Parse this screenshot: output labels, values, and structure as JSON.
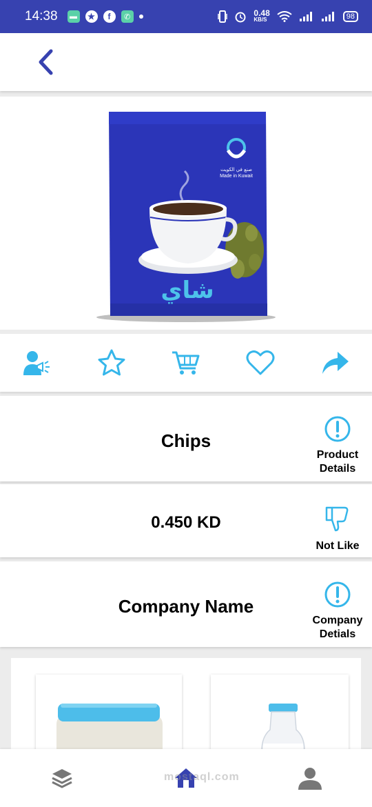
{
  "status_bar": {
    "time": "14:38",
    "network_speed": "0.48",
    "network_unit": "KB/S",
    "battery": "98"
  },
  "product_image": {
    "package_brand_line": "صنع في الكويت",
    "package_made_in": "Made in Kuwait",
    "package_title": "شاي",
    "colors": {
      "package": "#2b35b8",
      "accent": "#4dc3ea"
    }
  },
  "actions": {
    "icons": [
      "advertise-icon",
      "star-icon",
      "cart-icon",
      "heart-icon",
      "share-icon"
    ],
    "accent_color": "#35b6ea"
  },
  "product": {
    "name": "Chips",
    "price": "0.450 KD",
    "company": "Company Name",
    "details_label_line1": "Product",
    "details_label_line2": "Details",
    "not_like_label": "Not Like",
    "company_label_line1": "Company",
    "company_label_line2": "Detials"
  },
  "bottom_nav": {
    "icons": [
      "layers-icon",
      "home-icon",
      "profile-icon"
    ],
    "watermark": "mostaql.com",
    "home_color": "#3742b0",
    "inactive_color": "#777777"
  }
}
